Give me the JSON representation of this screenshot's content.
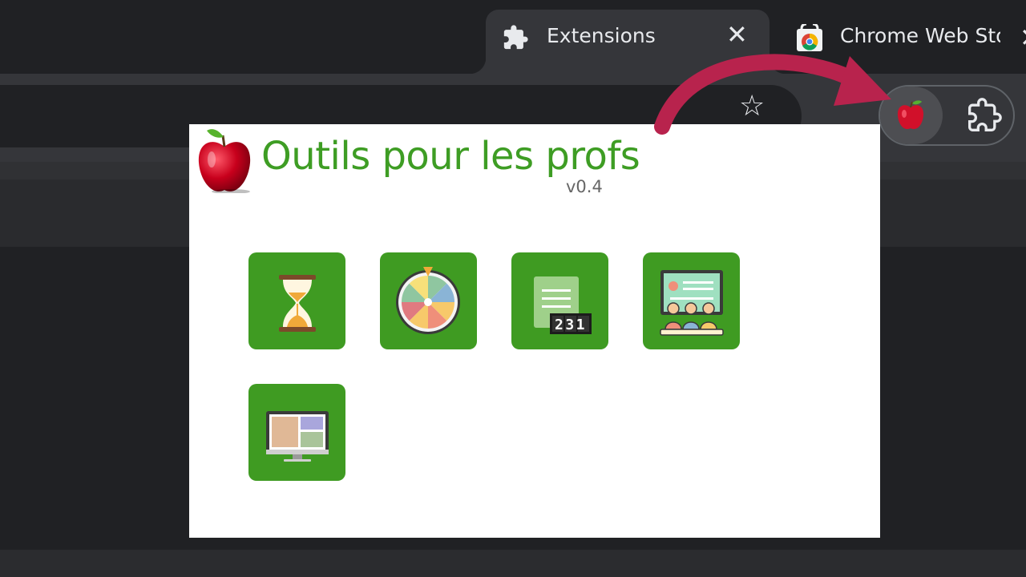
{
  "tabs": [
    {
      "title": "Extensions",
      "icon": "puzzle-icon",
      "active": true
    },
    {
      "title": "Chrome Web Sto",
      "icon": "chrome-web-store-icon",
      "active": false
    }
  ],
  "toolbar": {
    "bookmark_icon": "star-icon",
    "extension_icon": "apple-icon",
    "extensions_menu_icon": "puzzle-icon"
  },
  "popup": {
    "title": "Outils pour les profs",
    "version": "v0.4",
    "tools": [
      {
        "icon": "hourglass-icon"
      },
      {
        "icon": "wheel-of-fortune-icon"
      },
      {
        "icon": "number-counter-icon",
        "digits": "231"
      },
      {
        "icon": "classroom-presentation-icon"
      },
      {
        "icon": "desktop-monitor-icon"
      }
    ]
  },
  "colors": {
    "accent_green": "#3f9b22",
    "title_green": "#3e9d24",
    "arrow": "#b8234d"
  }
}
